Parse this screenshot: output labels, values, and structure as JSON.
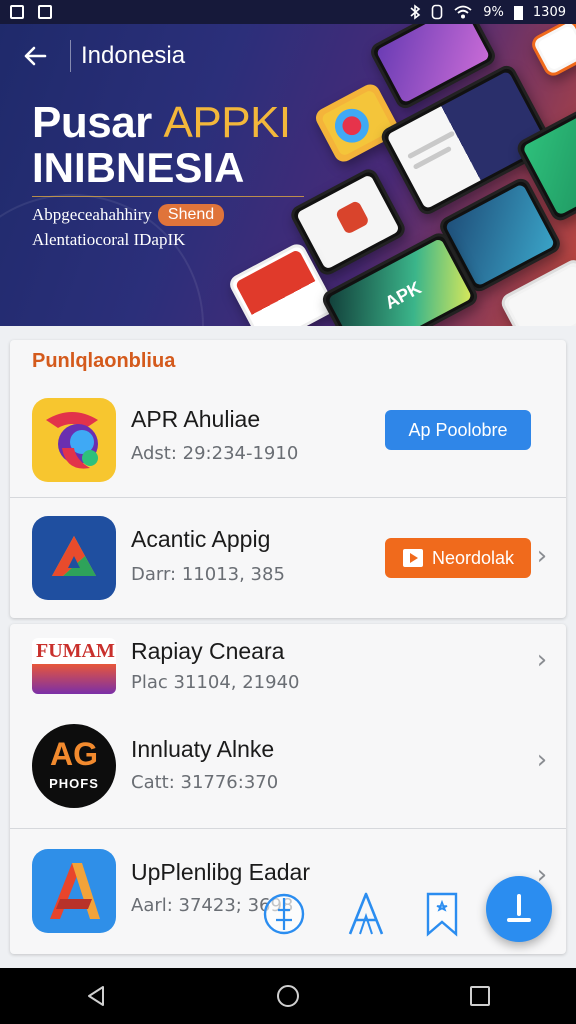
{
  "status_bar": {
    "time": "1309",
    "battery": "9%"
  },
  "header": {
    "title": "Indonesia"
  },
  "hero": {
    "title_line1_a": "Pusar",
    "title_line1_b": "APPKI",
    "title_line2": "INIBNESIA",
    "tagline": "Abpgeceahahhiry",
    "tag_chip": "Shend",
    "subtitle": "Alentatiocoral IDapIK",
    "phone_label_1": "APK"
  },
  "section": {
    "title": "Punlqlaonbliua"
  },
  "apps": [
    {
      "name": "APR Ahuliae",
      "meta": "Adst: 29:234-1910",
      "action": "Ap Poolobre"
    },
    {
      "name": "Acantic Appig",
      "meta": "Darr: 11013, 385",
      "action": "Neordolak"
    },
    {
      "name": "Rapiay Cneara",
      "meta": "Plac 31104, 21940",
      "icon_text": "FUMAM"
    },
    {
      "name": "Innluaty Alnke",
      "meta": "Catt: 31776:370",
      "icon_text_top": "AG",
      "icon_text_bottom": "PHOFS"
    },
    {
      "name": "UpPlenlibg Eadar",
      "meta": "Aarl: 37423; 3698"
    }
  ],
  "colors": {
    "accent_orange": "#d45a1c",
    "button_blue": "#2f86e8",
    "button_orange": "#f06a1c",
    "fab_blue": "#2b8df0"
  },
  "icons": {
    "back": "arrow-left-icon",
    "fab": "download-icon",
    "tools": [
      "compass-icon",
      "text-a-icon",
      "bookmark-icon"
    ],
    "nav": [
      "back-triangle-icon",
      "home-circle-icon",
      "recents-square-icon"
    ]
  }
}
